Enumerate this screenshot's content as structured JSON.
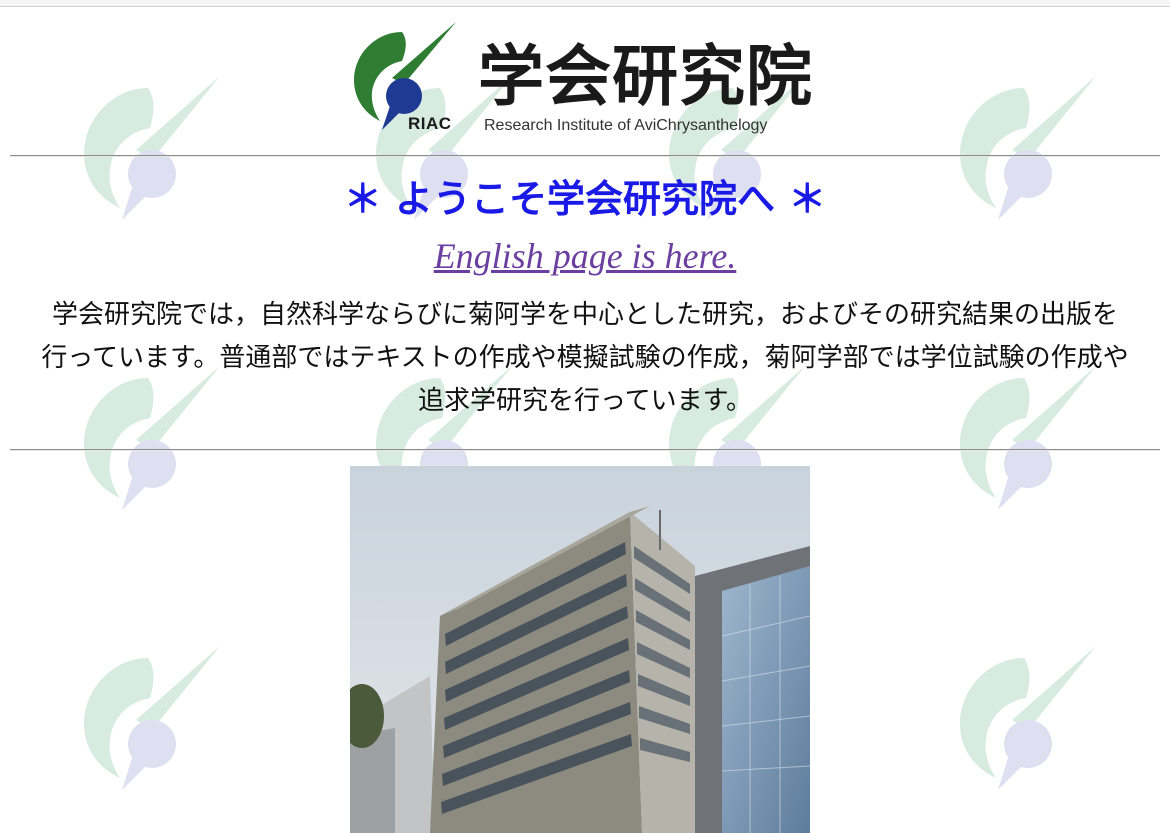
{
  "logo": {
    "title": "学会研究院",
    "abbr": "RIAC",
    "subtitle": "Research Institute of AviChrysanthelogy"
  },
  "welcome": "＊ ようこそ学会研究院へ ＊",
  "english_link": "English page is here.",
  "intro": "学会研究院では，自然科学ならびに菊阿学を中心とした研究，およびその研究結果の出版を行っています。普通部ではテキストの作成や模擬試験の作成，菊阿学部では学位試験の作成や追求学研究を行っています。",
  "colors": {
    "welcome_text": "#1a1ae6",
    "link": "#6b3fa0",
    "logo_green": "#2e7d32",
    "logo_navy": "#1f3a93",
    "watermark_green": "#d8ebe0",
    "watermark_lilac": "#dedff0"
  },
  "photo": {
    "subject": "building-photo"
  }
}
